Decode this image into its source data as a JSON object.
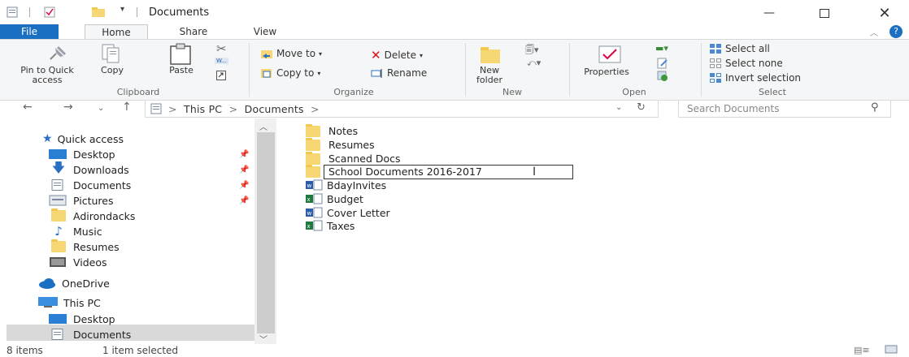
{
  "window": {
    "title": "Documents"
  },
  "tabs": [
    "File",
    "Home",
    "Share",
    "View"
  ],
  "ribbon": {
    "clipboard": {
      "pin_label_1": "Pin to Quick",
      "pin_label_2": "access",
      "copy": "Copy",
      "paste": "Paste",
      "group": "Clipboard"
    },
    "organize": {
      "move_to": "Move to",
      "copy_to": "Copy to",
      "delete": "Delete",
      "rename": "Rename",
      "group": "Organize"
    },
    "new": {
      "new_folder_1": "New",
      "new_folder_2": "folder",
      "group": "New"
    },
    "open": {
      "properties": "Properties",
      "group": "Open"
    },
    "select": {
      "select_all": "Select all",
      "select_none": "Select none",
      "invert": "Invert selection",
      "group": "Select"
    }
  },
  "address": {
    "crumb_root": "This PC",
    "crumb_current": "Documents",
    "search_placeholder": "Search Documents"
  },
  "nav": {
    "quick_access": "Quick access",
    "items": [
      "Desktop",
      "Downloads",
      "Documents",
      "Pictures",
      "Adirondacks",
      "Music",
      "Resumes",
      "Videos"
    ],
    "onedrive": "OneDrive",
    "this_pc": "This PC",
    "pc_items": [
      "Desktop",
      "Documents"
    ]
  },
  "files": {
    "folders": [
      "Notes",
      "Resumes",
      "Scanned Docs"
    ],
    "rename_value": "School Documents 2016-2017",
    "docs": [
      {
        "name": "BdayInvites",
        "kind": "word"
      },
      {
        "name": "Budget",
        "kind": "excel"
      },
      {
        "name": "Cover Letter",
        "kind": "word"
      },
      {
        "name": "Taxes",
        "kind": "excel"
      }
    ]
  },
  "status": {
    "count": "8 items",
    "selected": "1 item selected"
  },
  "colors": {
    "accent": "#1a6fc2",
    "folder": "#f7d774",
    "selection": "#d9d9d9"
  }
}
